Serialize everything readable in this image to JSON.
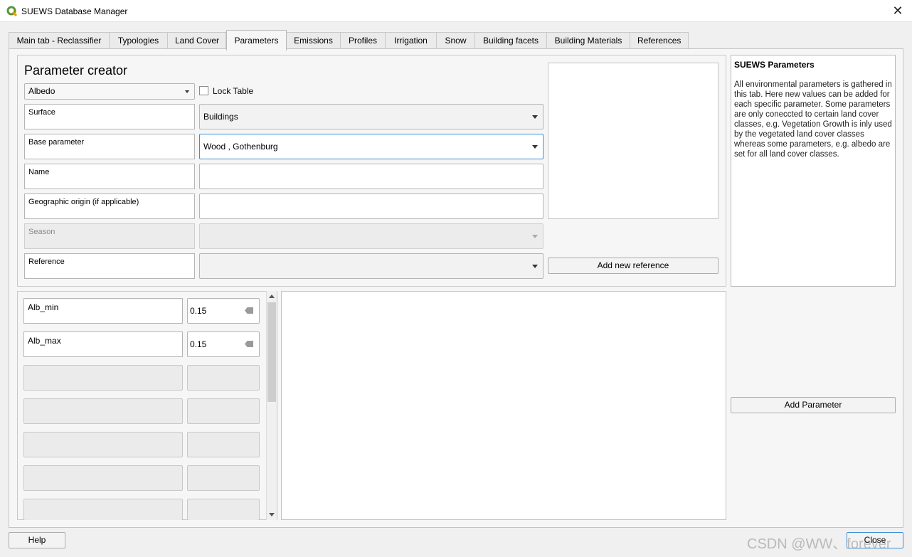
{
  "window": {
    "title": "SUEWS Database Manager",
    "icon": "qgis-icon",
    "close_glyph": "✕"
  },
  "tabs": [
    "Main tab - Reclassifier",
    "Typologies",
    "Land Cover",
    "Parameters",
    "Emissions",
    "Profiles",
    "Irrigation",
    "Snow",
    "Building facets",
    "Building Materials",
    "References"
  ],
  "active_tab": "Parameters",
  "creator": {
    "title": "Parameter creator",
    "parameter_select": "Albedo",
    "lock_table_label": "Lock Table",
    "lock_table_checked": false,
    "fields": {
      "surface": {
        "label": "Surface",
        "value": "Buildings"
      },
      "base_parameter": {
        "label": "Base parameter",
        "value": "Wood , Gothenburg"
      },
      "name": {
        "label": "Name",
        "value": ""
      },
      "geographic_origin": {
        "label": "Geographic origin (if applicable)",
        "value": ""
      },
      "season": {
        "label": "Season",
        "value": ""
      },
      "reference": {
        "label": "Reference",
        "value": ""
      }
    },
    "add_reference_button": "Add new reference"
  },
  "parameters": [
    {
      "name": "Alb_min",
      "value": "0.15"
    },
    {
      "name": "Alb_max",
      "value": "0.15"
    }
  ],
  "info": {
    "title": "SUEWS Parameters",
    "body": "All environmental parameters is gathered in this tab. Here new values can be added for each specific parameter. Some parameters are only coneccted to certain land cover classes, e.g. Vegetation Growth is inly used by the vegetated land cover classes whereas some parameters, e.g. albedo are set for all land cover classes."
  },
  "add_parameter_button": "Add Parameter",
  "footer": {
    "help_button": "Help",
    "close_button": "Close"
  },
  "watermark": "CSDN @WW、forever",
  "colors": {
    "focus_border": "#3b8ed6",
    "window_bg": "#f0f0f0"
  }
}
